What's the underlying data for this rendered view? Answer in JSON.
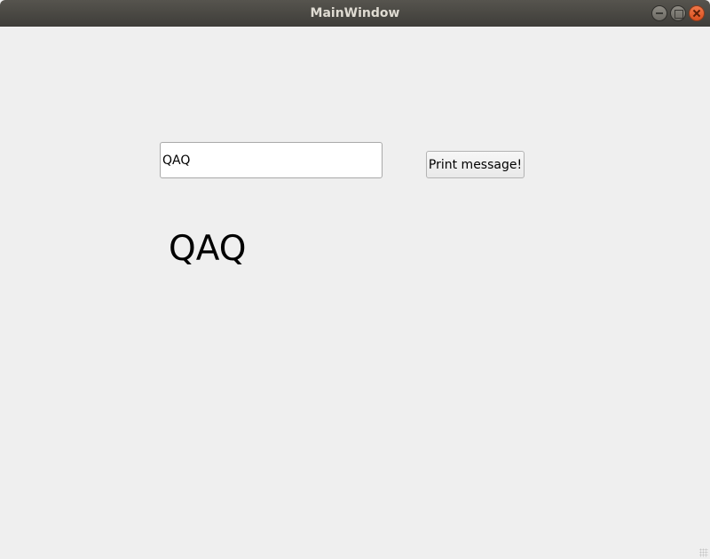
{
  "window": {
    "title": "MainWindow",
    "controls": [
      "minimize-icon",
      "maximize-icon",
      "close-icon"
    ]
  },
  "form": {
    "input_value": "QAQ",
    "button_label": "Print message!",
    "output_text": "QAQ"
  },
  "colors": {
    "background": "#efefef",
    "titlebar": "#3e3d39",
    "close_button": "#e05a28"
  }
}
